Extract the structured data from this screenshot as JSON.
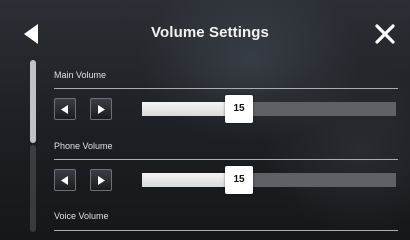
{
  "header": {
    "title": "Volume Settings",
    "back_icon": "back-arrow-icon",
    "close_icon": "close-icon"
  },
  "settings": [
    {
      "label": "Main Volume",
      "value": "15",
      "level": 0.38
    },
    {
      "label": "Phone Volume",
      "value": "15",
      "level": 0.38
    },
    {
      "label": "Voice Volume"
    }
  ],
  "scrollbar": {
    "thumb_fraction": 0.48
  },
  "colors": {
    "background": "#1c1f23",
    "slider_fill": "#e6e6e6",
    "slider_track": "#5e6166",
    "text": "#f2f2f2"
  }
}
